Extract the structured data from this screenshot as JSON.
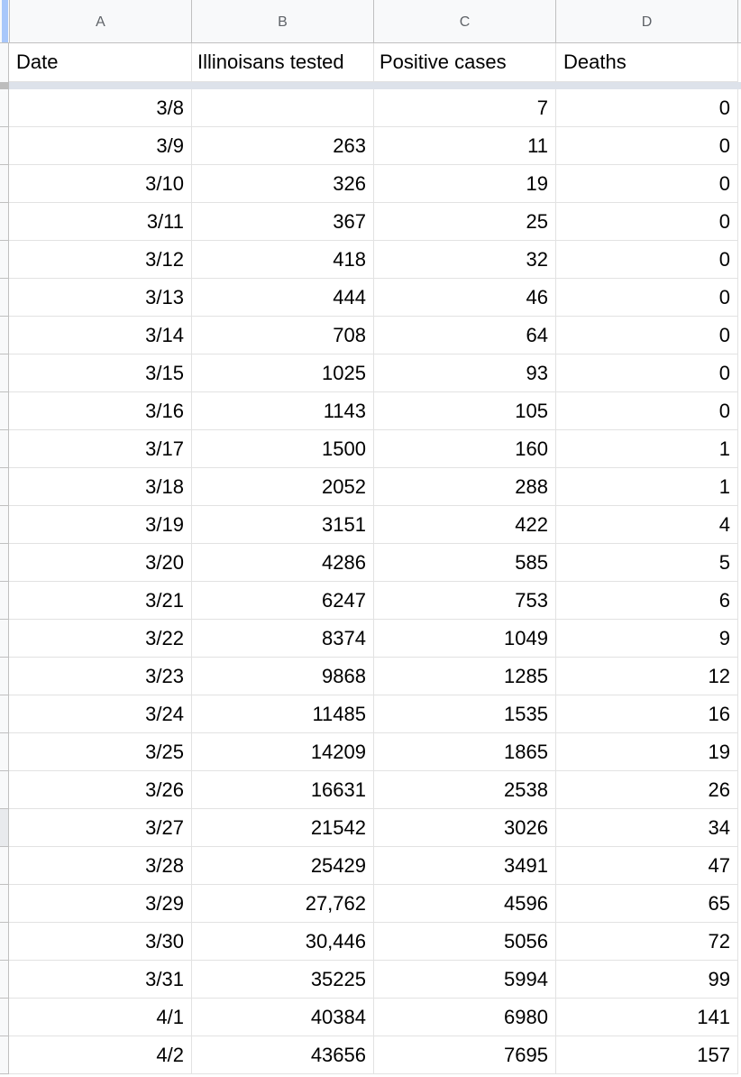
{
  "columns": [
    "A",
    "B",
    "C",
    "D"
  ],
  "header_row": [
    "Date",
    "Illinoisans tested",
    "Positive cases",
    "Deaths"
  ],
  "rows": [
    [
      "3/8",
      "",
      "7",
      "0"
    ],
    [
      "3/9",
      "263",
      "11",
      "0"
    ],
    [
      "3/10",
      "326",
      "19",
      "0"
    ],
    [
      "3/11",
      "367",
      "25",
      "0"
    ],
    [
      "3/12",
      "418",
      "32",
      "0"
    ],
    [
      "3/13",
      "444",
      "46",
      "0"
    ],
    [
      "3/14",
      "708",
      "64",
      "0"
    ],
    [
      "3/15",
      "1025",
      "93",
      "0"
    ],
    [
      "3/16",
      "1143",
      "105",
      "0"
    ],
    [
      "3/17",
      "1500",
      "160",
      "1"
    ],
    [
      "3/18",
      "2052",
      "288",
      "1"
    ],
    [
      "3/19",
      "3151",
      "422",
      "4"
    ],
    [
      "3/20",
      "4286",
      "585",
      "5"
    ],
    [
      "3/21",
      "6247",
      "753",
      "6"
    ],
    [
      "3/22",
      "8374",
      "1049",
      "9"
    ],
    [
      "3/23",
      "9868",
      "1285",
      "12"
    ],
    [
      "3/24",
      "11485",
      "1535",
      "16"
    ],
    [
      "3/25",
      "14209",
      "1865",
      "19"
    ],
    [
      "3/26",
      "16631",
      "2538",
      "26"
    ],
    [
      "3/27",
      "21542",
      "3026",
      "34"
    ],
    [
      "3/28",
      "25429",
      "3491",
      "47"
    ],
    [
      "3/29",
      "27,762",
      "4596",
      "65"
    ],
    [
      "3/30",
      "30,446",
      "5056",
      "72"
    ],
    [
      "3/31",
      "35225",
      "5994",
      "99"
    ],
    [
      "4/1",
      "40384",
      "6980",
      "141"
    ],
    [
      "4/2",
      "43656",
      "7695",
      "157"
    ]
  ],
  "colors": {
    "header_bg": "#f8f9fa",
    "header_text": "#5f6368",
    "gridline": "#e2e2e2",
    "frozen_bar": "#dde2ea",
    "selection": "#a8c7fa"
  }
}
